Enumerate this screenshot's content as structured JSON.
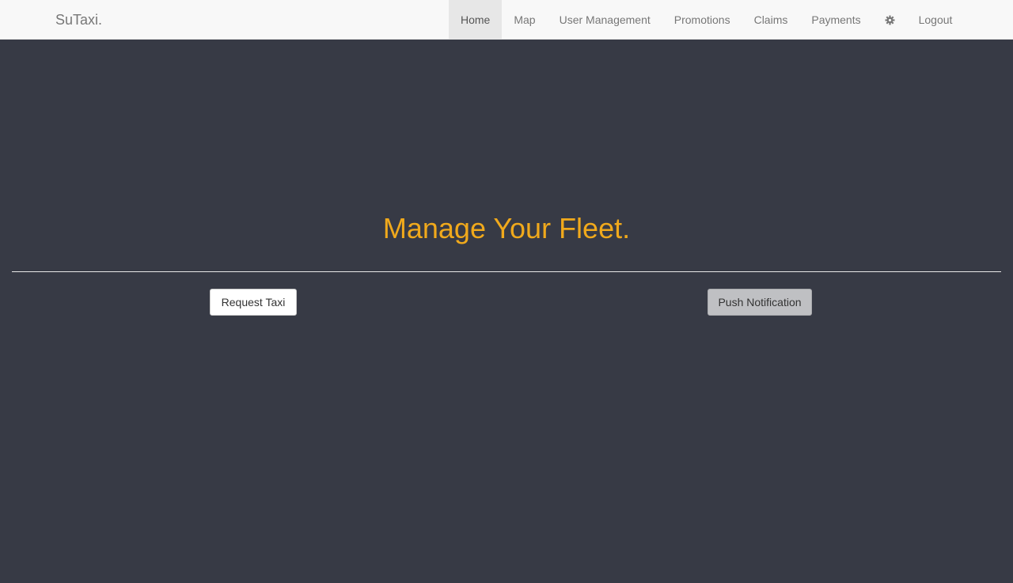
{
  "navbar": {
    "brand": "SuTaxi.",
    "items": [
      {
        "label": "Home",
        "active": true
      },
      {
        "label": "Map"
      },
      {
        "label": "User Management"
      },
      {
        "label": "Promotions"
      },
      {
        "label": "Claims"
      },
      {
        "label": "Payments"
      }
    ],
    "settings_icon": "gear-icon",
    "logout_label": "Logout"
  },
  "main": {
    "headline": "Manage Your Fleet.",
    "request_taxi_label": "Request Taxi",
    "push_notification_label": "Push Notification"
  },
  "colors": {
    "background": "#373a45",
    "navbar": "#f8f8f8",
    "headline": "#f0a91c"
  }
}
